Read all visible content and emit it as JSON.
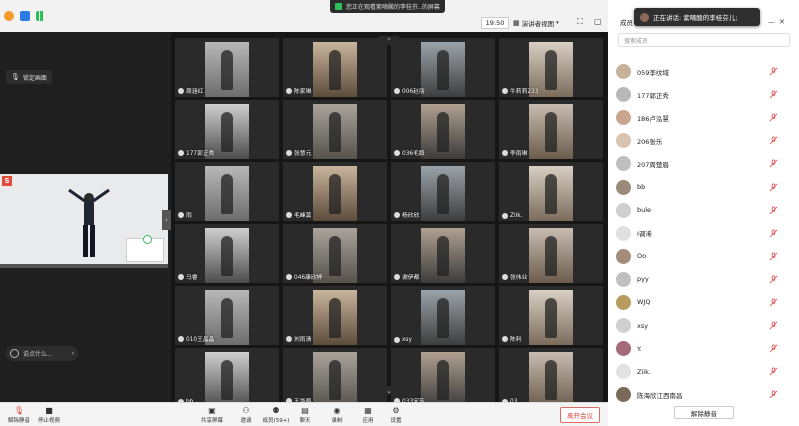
{
  "window": {
    "share_banner": "您正在观看紫嘀酸的李桂芬..的屏幕",
    "clock": "19:50",
    "view_mode": "演讲者视图",
    "members_top": "成员",
    "speaking_now": "正在讲话: 紫嘀酸的李桂芬儿;"
  },
  "left": {
    "camera_tag": "锁定画面",
    "chat_placeholder": "说点什么...",
    "main_badge": "S",
    "collapse_glyph": "›"
  },
  "grid": {
    "up_arrow": "⌃",
    "down_arrow": "⌄",
    "tiles": [
      {
        "name": "周涵红"
      },
      {
        "name": "陈家琳"
      },
      {
        "name": "006赵丽"
      },
      {
        "name": "牛莉莉233"
      },
      {
        "name": "177郭正秀"
      },
      {
        "name": "张慧元"
      },
      {
        "name": "036毛毅"
      },
      {
        "name": "李雨琳"
      },
      {
        "name": "雨"
      },
      {
        "name": "毛峰莫"
      },
      {
        "name": "杨欣欣"
      },
      {
        "name": "Ziik."
      },
      {
        "name": "马睿"
      },
      {
        "name": "046康欣婷"
      },
      {
        "name": "谢伊都"
      },
      {
        "name": "张伟业"
      },
      {
        "name": "010王晶晶"
      },
      {
        "name": "刘雨清"
      },
      {
        "name": "xsy"
      },
      {
        "name": "陈利"
      },
      {
        "name": "bb"
      },
      {
        "name": "王华爵"
      },
      {
        "name": "033宋芳"
      },
      {
        "name": "03"
      }
    ]
  },
  "toolbar": {
    "mute": "解除静音",
    "stop_video": "停止视频",
    "share_screen": "共享屏幕",
    "invite": "邀请",
    "members": "成员(59+)",
    "chat": "聊天",
    "record": "录制",
    "apps": "应用",
    "settings": "设置",
    "leave": "离开会议"
  },
  "panel": {
    "search_placeholder": "搜索成员",
    "mute_all": "解除静音",
    "members": [
      {
        "name": "059李纹域"
      },
      {
        "name": "177郭正秀"
      },
      {
        "name": "186卢泓慧"
      },
      {
        "name": "206张乐"
      },
      {
        "name": "207周楚眉"
      },
      {
        "name": "bb"
      },
      {
        "name": "bule"
      },
      {
        "name": "I调浠"
      },
      {
        "name": "Oo"
      },
      {
        "name": "pyy"
      },
      {
        "name": "WJQ"
      },
      {
        "name": "xsy"
      },
      {
        "name": "Y."
      },
      {
        "name": "Ziik."
      },
      {
        "name": "陈海欣江西南昌"
      }
    ]
  },
  "colors": {
    "accent_red": "#d9453b",
    "mute_red": "#e05a5a",
    "share_green": "#2fbf5b"
  }
}
